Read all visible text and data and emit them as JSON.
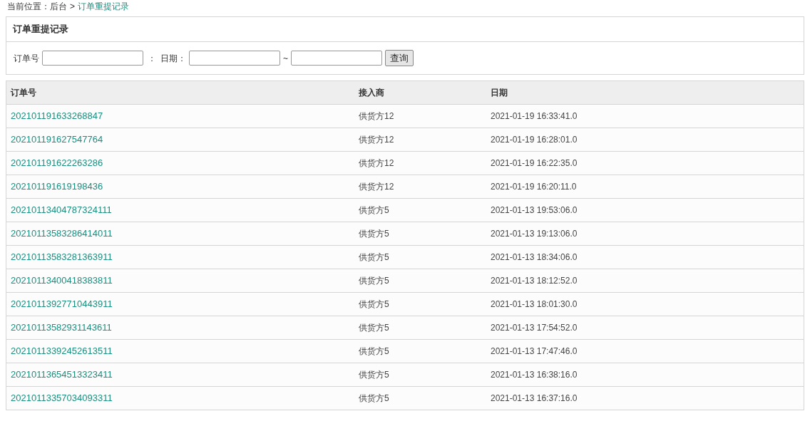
{
  "breadcrumb": {
    "label": "当前位置：",
    "items": [
      {
        "text": "后台",
        "current": false
      },
      {
        "text": "订单重提记录",
        "current": true
      }
    ],
    "separator": ">"
  },
  "panel": {
    "title": "订单重提记录"
  },
  "filters": {
    "order_label": "订单号",
    "order_sep": "：",
    "date_label": "日期：",
    "range_sep": "~",
    "query_button": "查询"
  },
  "table": {
    "columns": [
      "订单号",
      "接入商",
      "日期"
    ],
    "rows": [
      [
        "202101191633268847",
        "供货方12",
        "2021-01-19 16:33:41.0"
      ],
      [
        "202101191627547764",
        "供货方12",
        "2021-01-19 16:28:01.0"
      ],
      [
        "202101191622263286",
        "供货方12",
        "2021-01-19 16:22:35.0"
      ],
      [
        "202101191619198436",
        "供货方12",
        "2021-01-19 16:20:11.0"
      ],
      [
        "20210113404787324111",
        "供货方5",
        "2021-01-13 19:53:06.0"
      ],
      [
        "20210113583286414011",
        "供货方5",
        "2021-01-13 19:13:06.0"
      ],
      [
        "20210113583281363911",
        "供货方5",
        "2021-01-13 18:34:06.0"
      ],
      [
        "20210113400418383811",
        "供货方5",
        "2021-01-13 18:12:52.0"
      ],
      [
        "20210113927710443911",
        "供货方5",
        "2021-01-13 18:01:30.0"
      ],
      [
        "20210113582931143611",
        "供货方5",
        "2021-01-13 17:54:52.0"
      ],
      [
        "20210113392452613511",
        "供货方5",
        "2021-01-13 17:47:46.0"
      ],
      [
        "20210113654513323411",
        "供货方5",
        "2021-01-13 16:38:16.0"
      ],
      [
        "20210113357034093311",
        "供货方5",
        "2021-01-13 16:37:16.0"
      ]
    ]
  }
}
